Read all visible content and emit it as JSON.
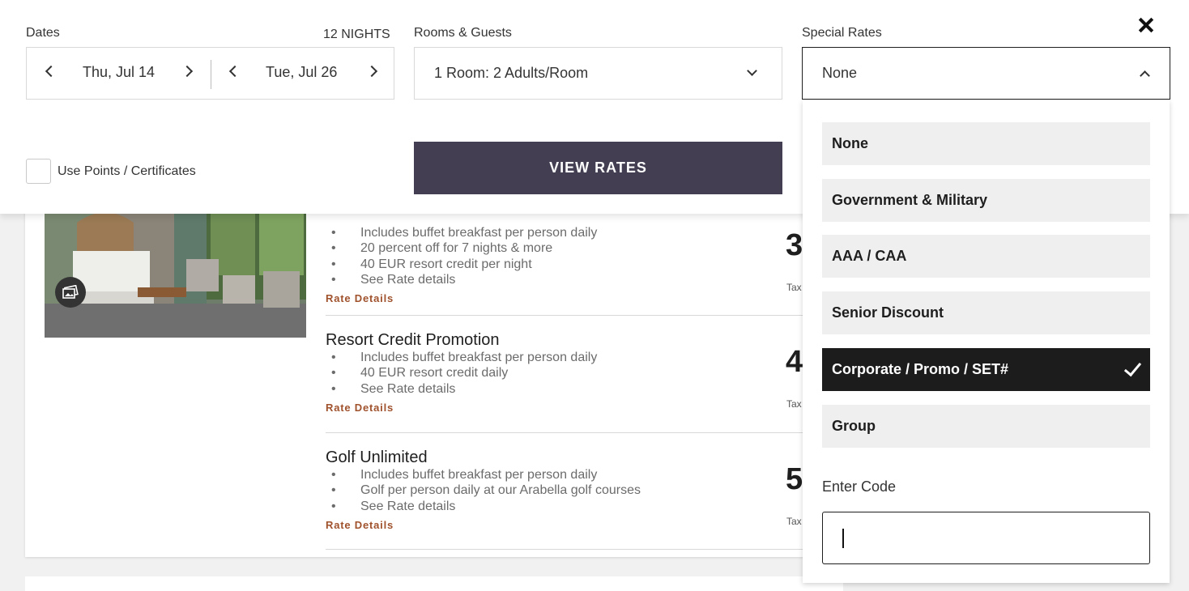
{
  "search": {
    "dates_label": "Dates",
    "nights": "12 NIGHTS",
    "checkin": "Thu, Jul 14",
    "checkout": "Tue, Jul 26",
    "rooms_label": "Rooms & Guests",
    "rooms_value": "1 Room: 2 Adults/Room",
    "special_rates_label": "Special Rates",
    "special_rates_value": "None",
    "use_points_label": "Use Points / Certificates",
    "view_rates_button": "VIEW RATES"
  },
  "dropdown": {
    "options": [
      {
        "label": "None",
        "selected": false
      },
      {
        "label": "Government & Military",
        "selected": false
      },
      {
        "label": "AAA / CAA",
        "selected": false
      },
      {
        "label": "Senior Discount",
        "selected": false
      },
      {
        "label": "Corporate / Promo / SET#",
        "selected": true
      },
      {
        "label": "Group",
        "selected": false
      }
    ],
    "enter_code_label": "Enter Code",
    "code_value": ""
  },
  "rates": [
    {
      "title": "",
      "bullets": [
        "Includes buffet breakfast per person daily",
        "20 percent off for 7 nights & more",
        "40 EUR resort credit per night",
        "See Rate details"
      ],
      "link": "Rate Details",
      "price_partial": "3",
      "tax_partial": "Tax"
    },
    {
      "title": "Resort Credit Promotion",
      "bullets": [
        "Includes buffet breakfast per person daily",
        "40 EUR resort credit daily",
        "See Rate details"
      ],
      "link": "Rate Details",
      "price_partial": "4",
      "tax_partial": "Tax"
    },
    {
      "title": "Golf Unlimited",
      "bullets": [
        "Includes buffet breakfast per person daily",
        "Golf per person daily at our Arabella golf courses",
        "See Rate details"
      ],
      "link": "Rate Details",
      "price_partial": "5",
      "tax_partial": "Tax"
    }
  ],
  "colors": {
    "button_bg": "#433e52",
    "selected_option_bg": "#1c1c1c",
    "link": "#a0522d"
  }
}
